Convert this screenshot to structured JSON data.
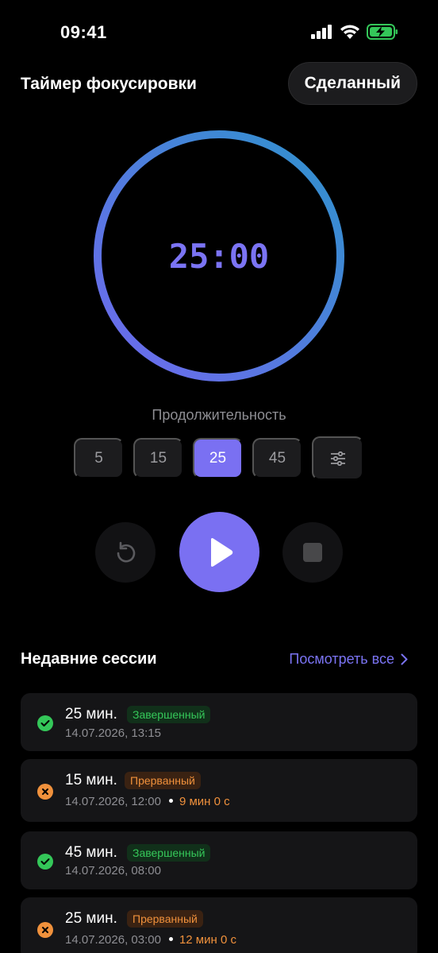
{
  "status_bar": {
    "time": "09:41"
  },
  "header": {
    "title": "Таймер фокусировки",
    "done_label": "Сделанный"
  },
  "timer": {
    "display": "25:00",
    "progress": 1.0,
    "gradient": [
      "#2e93cc",
      "#7068ee"
    ]
  },
  "duration": {
    "label": "Продолжительность",
    "options": [
      "5",
      "15",
      "25",
      "45"
    ],
    "selected": "25",
    "settings_icon": "sliders-icon"
  },
  "controls": {
    "reset_icon": "reset-icon",
    "play_icon": "play-icon",
    "stop_icon": "stop-icon"
  },
  "recent": {
    "title": "Недавние сессии",
    "view_all": "Посмотреть все",
    "sessions": [
      {
        "duration": "25 мин.",
        "status": "Завершенный",
        "state": "completed",
        "date": "14.07.2026, 13:15",
        "elapsed": ""
      },
      {
        "duration": "15 мин.",
        "status": "Прерванный",
        "state": "interrupted",
        "date": "14.07.2026, 12:00",
        "elapsed": "9 мин 0 с"
      },
      {
        "duration": "45 мин.",
        "status": "Завершенный",
        "state": "completed",
        "date": "14.07.2026, 08:00",
        "elapsed": ""
      },
      {
        "duration": "25 мин.",
        "status": "Прерванный",
        "state": "interrupted",
        "date": "14.07.2026, 03:00",
        "elapsed": "12 мин 0 с"
      }
    ]
  },
  "colors": {
    "accent": "#7a70f2",
    "success": "#34c759",
    "warning": "#f0913c",
    "background": "#000000"
  }
}
